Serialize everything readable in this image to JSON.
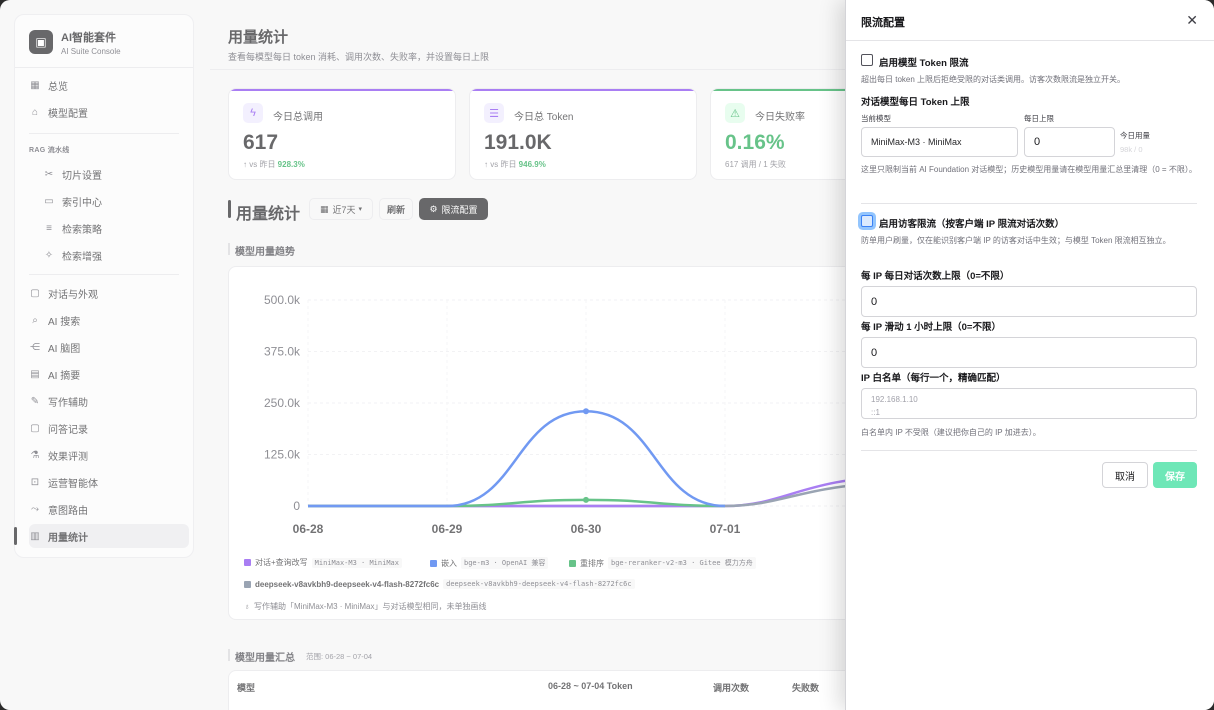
{
  "brand": {
    "title": "AI智能套件",
    "subtitle": "AI Suite Console"
  },
  "sidebar": {
    "items_top": [
      {
        "label": "总览",
        "icon": "grid-icon"
      },
      {
        "label": "模型配置",
        "icon": "box-icon"
      }
    ],
    "section_rag": "RAG 流水线",
    "items_rag": [
      {
        "label": "切片设置",
        "icon": "scissors-icon"
      },
      {
        "label": "索引中心",
        "icon": "folder-icon"
      },
      {
        "label": "检索策略",
        "icon": "filter-icon"
      },
      {
        "label": "检索增强",
        "icon": "sparkle-icon"
      }
    ],
    "items_bottom": [
      {
        "label": "对话与外观",
        "icon": "message-icon"
      },
      {
        "label": "AI 搜索",
        "icon": "search-icon"
      },
      {
        "label": "AI 脑图",
        "icon": "mindmap-icon"
      },
      {
        "label": "AI 摘要",
        "icon": "document-icon"
      },
      {
        "label": "写作辅助",
        "icon": "pen-icon"
      },
      {
        "label": "问答记录",
        "icon": "chat-icon"
      },
      {
        "label": "效果评测",
        "icon": "flask-icon"
      },
      {
        "label": "运营智能体",
        "icon": "robot-icon"
      },
      {
        "label": "意图路由",
        "icon": "route-icon"
      },
      {
        "label": "用量统计",
        "icon": "bar-chart-icon",
        "active": true
      }
    ]
  },
  "header": {
    "title": "用量统计",
    "subtitle": "查看每模型每日 token 消耗、调用次数、失败率，并设置每日上限"
  },
  "cards": [
    {
      "label": "今日总调用",
      "value": "617",
      "foot_prefix": "↑ vs 昨日 ",
      "foot_value": "928.3%",
      "icon": "bolt-icon",
      "color": "#7c3aed"
    },
    {
      "label": "今日总 Token",
      "value": "191.0K",
      "foot_prefix": "↑ vs 昨日 ",
      "foot_value": "946.9%",
      "icon": "database-icon",
      "color": "#7c3aed"
    },
    {
      "label": "今日失败率",
      "value": "0.16%",
      "foot_prefix": "617 调用 / 1 失败",
      "foot_value": "",
      "icon": "warning-icon",
      "color": "#16a34a"
    }
  ],
  "usage": {
    "title": "用量统计",
    "range_btn": "近7天",
    "refresh_btn": "刷新",
    "limit_btn": "限流配置",
    "trend_title": "模型用量趋势",
    "note": "写作辅助「MiniMax-M3 · MiniMax」与对话模型相同，未单独画线",
    "summary_title": "模型用量汇总",
    "summary_range": "范围: 06-28 ~ 07-04",
    "table_headers": [
      "模型",
      "06-28 ~ 07-04 Token",
      "调用次数",
      "失败数"
    ]
  },
  "chart_data": {
    "type": "line",
    "categories": [
      "06-28",
      "06-29",
      "06-30",
      "07-01"
    ],
    "y_ticks": [
      "500.0k",
      "375.0k",
      "250.0k",
      "125.0k",
      "0"
    ],
    "ylim": [
      0,
      500000
    ],
    "grid": true,
    "series": [
      {
        "name": "对话+查询改写",
        "tag": "MiniMax-M3 · MiniMax",
        "color": "#7c3aed",
        "values": [
          0,
          0,
          0,
          0
        ]
      },
      {
        "name": "嵌入",
        "tag": "bge-m3 · OpenAI 兼容",
        "color": "#2563eb",
        "values": [
          0,
          0,
          230000,
          0
        ]
      },
      {
        "name": "重排序",
        "tag": "bge-reranker-v2-m3 · Gitee 模力方舟",
        "color": "#16a34a",
        "values": [
          0,
          0,
          15000,
          0
        ]
      },
      {
        "name": "deepseek-v8avkbh9-deepseek-v4-flash-8272fc6c",
        "tag": "deepseek-v8avkbh9-deepseek-v4-flash-8272fc6c",
        "color": "#64748b",
        "values": [
          0,
          0,
          0,
          0
        ]
      }
    ]
  },
  "drawer": {
    "title": "限流配置",
    "token_limit_label": "启用模型 Token 限流",
    "token_limit_help": "超出每日 token 上限后拒绝受限的对话类调用。访客次数限流是独立开关。",
    "daily_cap_title": "对话模型每日 Token 上限",
    "current_model_label": "当前模型",
    "daily_limit_label": "每日上限",
    "today_usage_label": "今日用量",
    "current_model_value": "MiniMax-M3 · MiniMax",
    "daily_limit_value": "0",
    "today_usage_value": "98k / 0",
    "cap_help": "这里只限制当前 AI Foundation 对话模型；历史模型用量请在模型用量汇总里清理（0 = 不限）。",
    "visitor_limit_label": "启用访客限流（按客户端 IP 限流对话次数）",
    "visitor_help": "防单用户刷量，仅在能识别客户端 IP 的访客对话中生效；与模型 Token 限流相互独立。",
    "ip_daily_label": "每 IP 每日对话次数上限（0=不限）",
    "ip_daily_value": "0",
    "ip_hourly_label": "每 IP 滑动 1 小时上限（0=不限）",
    "ip_hourly_value": "0",
    "whitelist_label": "IP 白名单（每行一个，精确匹配）",
    "whitelist_placeholder": "192.168.1.10\n::1",
    "whitelist_help": "白名单内 IP 不受限（建议把你自己的 IP 加进去）。",
    "cancel": "取消",
    "save": "保存"
  }
}
